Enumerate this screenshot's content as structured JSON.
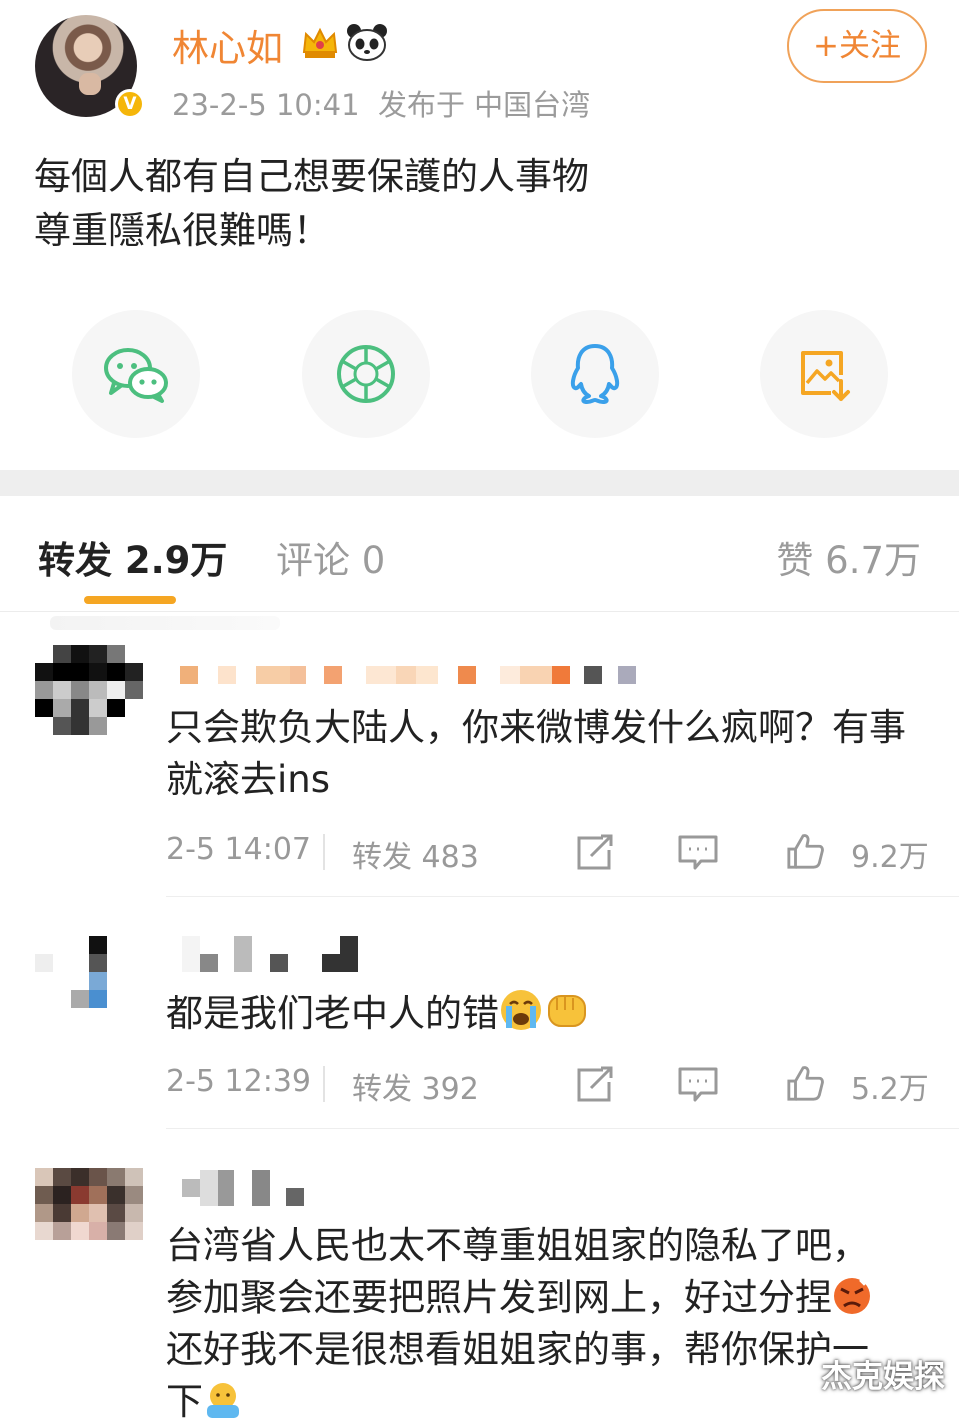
{
  "post": {
    "username": "林心如",
    "timestamp": "23-2-5 10:41",
    "location": "发布于 中国台湾",
    "follow_label": "+关注",
    "content_line1": "每個人都有自己想要保護的人事物",
    "content_line2": "尊重隱私很難嗎！",
    "badge_icon": "verified-v-icon",
    "badges": [
      "crown-icon",
      "panda-icon"
    ]
  },
  "share": [
    {
      "name": "wechat-icon",
      "color": "#4cbf7f"
    },
    {
      "name": "moments-icon",
      "color": "#4cbf7f"
    },
    {
      "name": "qq-icon",
      "color": "#3aa0ea"
    },
    {
      "name": "save-image-icon",
      "color": "#f5a623"
    }
  ],
  "tabs": {
    "reposts": "转发 2.9万",
    "comments": "评论 0",
    "likes": "赞 6.7万"
  },
  "reposts": [
    {
      "text": "只会欺负大陆人，你来微博发什么疯啊？有事就滚去ins",
      "time": "2-5 14:07",
      "repost_count": "转发 483",
      "likes": "9.2万"
    },
    {
      "text": "都是我们老中人的错",
      "time": "2-5 12:39",
      "repost_count": "转发 392",
      "likes": "5.2万",
      "emojis": [
        "crying-face-icon",
        "fist-icon"
      ]
    },
    {
      "text_line1": "台湾省人民也太不尊重姐姐家的隐私了吧，",
      "text_line2": "参加聚会还要把照片发到网上，好过分捏",
      "text_line3": "还好我不是很想看姐姐家的事，帮你保护一",
      "text_line4": "下",
      "emojis": [
        "angry-face-icon",
        "hiding-face-icon"
      ]
    }
  ],
  "watermark": "杰克娱探",
  "colors": {
    "accent": "#f08634",
    "tab_underline": "#f5a623",
    "muted": "#999999"
  }
}
